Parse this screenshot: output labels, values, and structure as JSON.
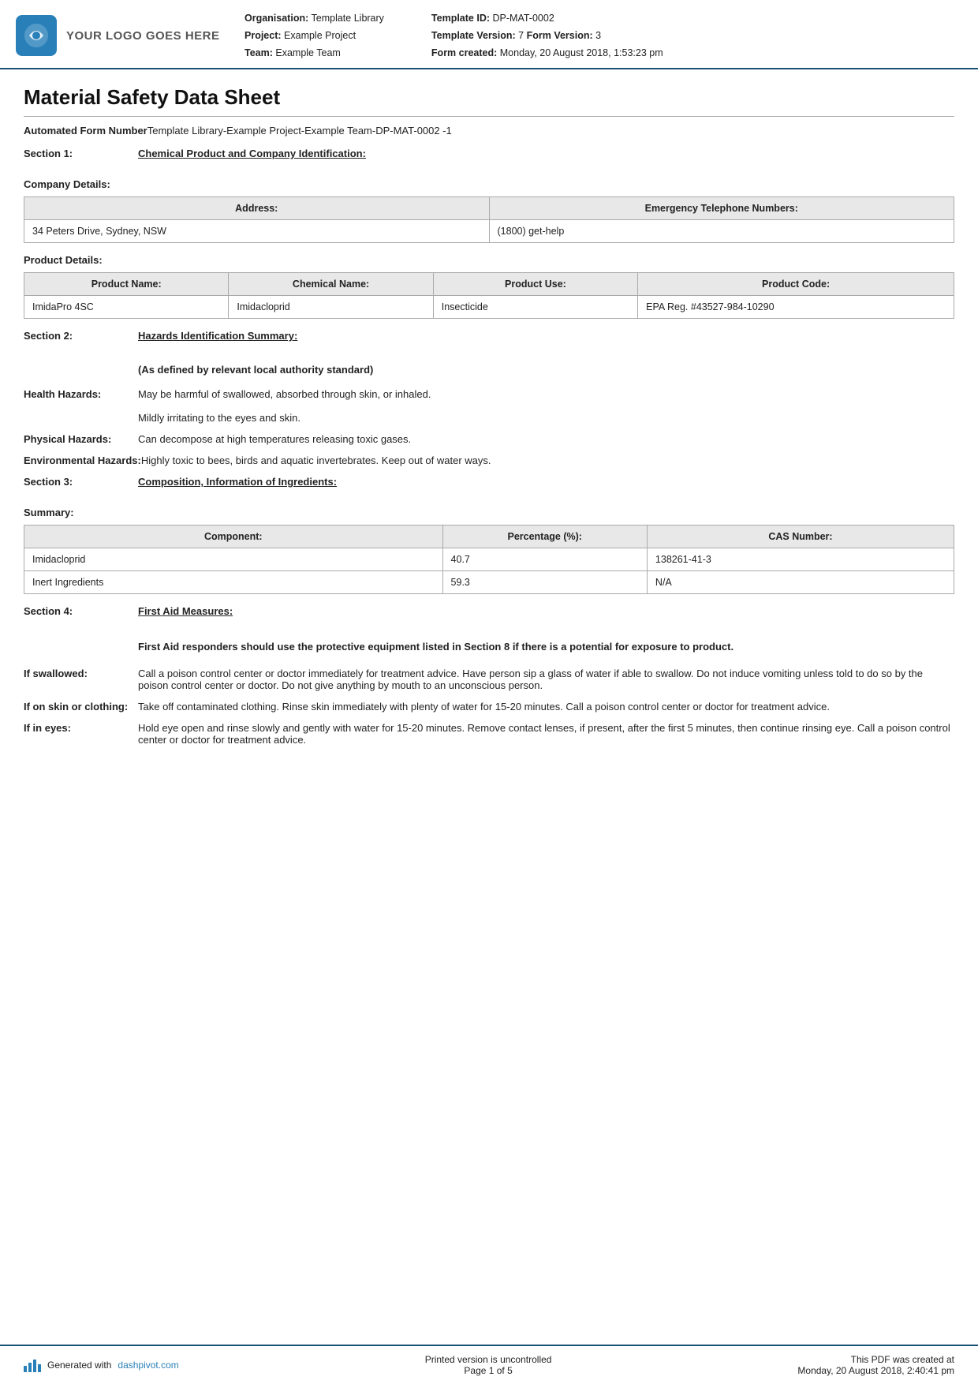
{
  "header": {
    "logo_text": "YOUR LOGO GOES HERE",
    "org_label": "Organisation:",
    "org_value": "Template Library",
    "project_label": "Project:",
    "project_value": "Example Project",
    "team_label": "Team:",
    "team_value": "Example Team",
    "template_id_label": "Template ID:",
    "template_id_value": "DP-MAT-0002",
    "template_version_label": "Template Version:",
    "template_version_value": "7",
    "form_version_label": "Form Version:",
    "form_version_value": "3",
    "form_created_label": "Form created:",
    "form_created_value": "Monday, 20 August 2018, 1:53:23 pm"
  },
  "doc_title": "Material Safety Data Sheet",
  "form_number": {
    "label": "Automated Form Number",
    "value": "Template Library-Example Project-Example Team-DP-MAT-0002   -1"
  },
  "section1": {
    "label": "Section 1:",
    "title": "Chemical Product and Company Identification:",
    "company_details_heading": "Company Details:",
    "company_table": {
      "headers": [
        "Address:",
        "Emergency Telephone Numbers:"
      ],
      "rows": [
        [
          "34 Peters Drive,\nSydney, NSW",
          "(1800) get-help"
        ]
      ]
    },
    "product_details_heading": "Product Details:",
    "product_table": {
      "headers": [
        "Product Name:",
        "Chemical Name:",
        "Product Use:",
        "Product Code:"
      ],
      "rows": [
        [
          "ImidaPro 4SC",
          "Imidacloprid",
          "Insecticide",
          "EPA Reg. #43527-984-10290"
        ]
      ]
    }
  },
  "section2": {
    "label": "Section 2:",
    "title": "Hazards Identification Summary:",
    "authority_note": "(As defined by relevant local authority standard)",
    "health_hazards_label": "Health Hazards:",
    "health_hazards_value": "May be harmful of swallowed, absorbed through skin, or inhaled.\n\nMildly irritating to the eyes and skin.",
    "physical_hazards_label": "Physical Hazards:",
    "physical_hazards_value": "Can decompose at high temperatures releasing toxic gases.",
    "environmental_hazards_label": "Environmental Hazards:",
    "environmental_hazards_value": "Highly toxic to bees, birds and aquatic invertebrates. Keep out of water ways."
  },
  "section3": {
    "label": "Section 3:",
    "title": "Composition, Information of Ingredients:",
    "summary_heading": "Summary:",
    "ingredients_table": {
      "headers": [
        "Component:",
        "Percentage (%):",
        "CAS Number:"
      ],
      "rows": [
        [
          "Imidacloprid",
          "40.7",
          "138261-41-3"
        ],
        [
          "Inert Ingredients",
          "59.3",
          "N/A"
        ]
      ]
    }
  },
  "section4": {
    "label": "Section 4:",
    "title": "First Aid Measures:",
    "note": "First Aid responders should use the protective equipment listed in Section 8 if there is a potential for exposure to product.",
    "if_swallowed_label": "If swallowed:",
    "if_swallowed_value": "Call a poison control center or doctor immediately for treatment advice. Have person sip a glass of water if able to swallow. Do not induce vomiting unless told to do so by the poison control center or doctor. Do not give anything by mouth to an unconscious person.",
    "if_on_skin_label": "If on skin or clothing:",
    "if_on_skin_value": "Take off contaminated clothing. Rinse skin immediately with plenty of water for 15-20 minutes. Call a poison control center or doctor for treatment advice.",
    "if_in_eyes_label": "If in eyes:",
    "if_in_eyes_value": "Hold eye open and rinse slowly and gently with water for 15-20 minutes. Remove contact lenses, if present, after the first 5 minutes, then continue rinsing eye. Call a poison control center or doctor for treatment advice."
  },
  "footer": {
    "generated_text": "Generated with",
    "site_link": "dashpivot.com",
    "page_text": "Printed version is uncontrolled",
    "page_number": "Page 1 of 5",
    "pdf_created_label": "This PDF was created at",
    "pdf_created_value": "Monday, 20 August 2018, 2:40:41 pm"
  }
}
